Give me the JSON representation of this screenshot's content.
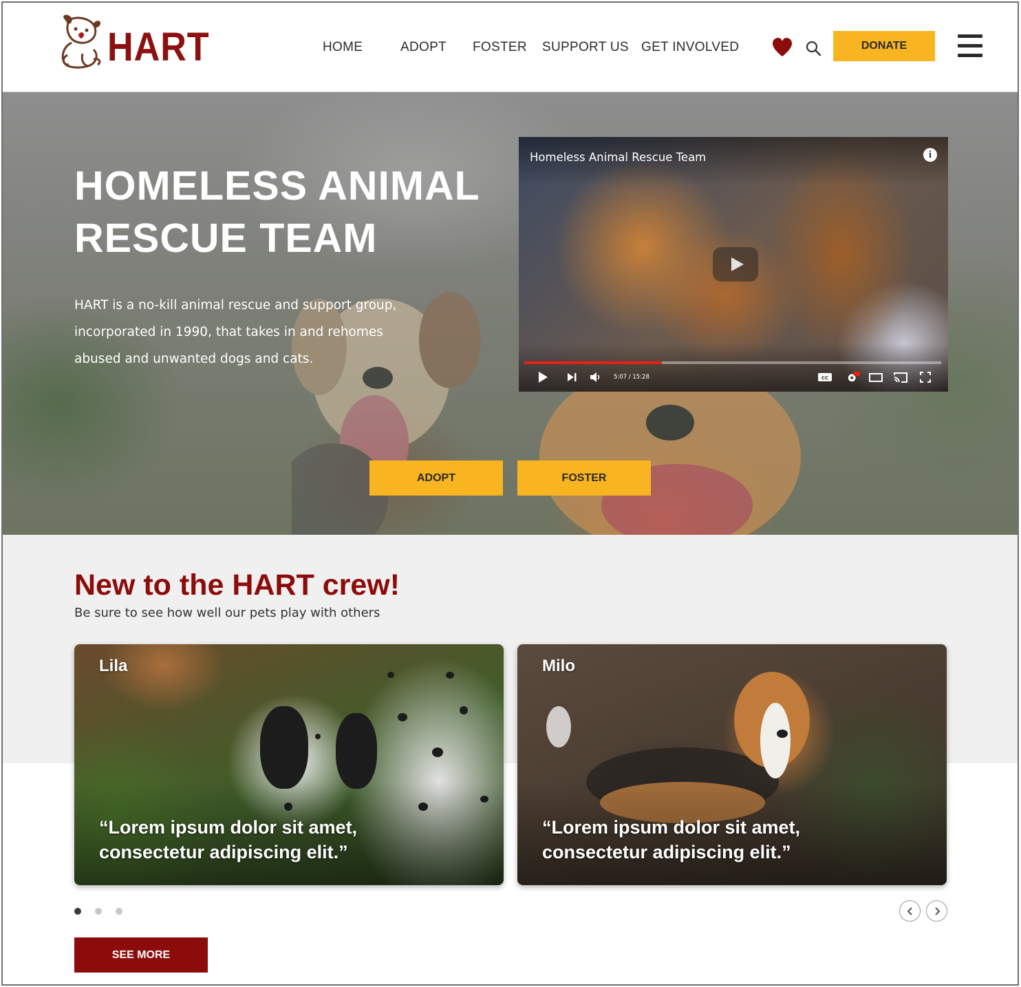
{
  "brand": {
    "name": "HART",
    "color": "#8c1010"
  },
  "nav": {
    "items": [
      {
        "label": "HOME"
      },
      {
        "label": "ADOPT"
      },
      {
        "label": "FOSTER"
      },
      {
        "label": "SUPPORT US"
      },
      {
        "label": "GET INVOLVED"
      }
    ],
    "donate_label": "DONATE",
    "icons": [
      "heart-icon",
      "search-icon",
      "menu-icon"
    ]
  },
  "hero": {
    "title_line1": "HOMELESS ANIMAL",
    "title_line2": "RESCUE TEAM",
    "description": "HART is a no-kill animal rescue and support group, incorporated in 1990, that takes in and rehomes abused and unwanted dogs and cats.",
    "adopt_label": "ADOPT",
    "foster_label": "FOSTER",
    "accent_color": "#f8b521"
  },
  "video": {
    "title": "Homeless Animal Rescue Team",
    "time_display": "5:07 / 15:28",
    "progress": 0.33,
    "progress_color": "#e62117"
  },
  "crew": {
    "title": "New to the HART crew!",
    "subtitle": "Be sure to see how well our pets play with others",
    "cards": [
      {
        "name": "Lila",
        "quote": "“Lorem ipsum dolor sit amet, consectetur adipiscing elit.”"
      },
      {
        "name": "Milo",
        "quote": "“Lorem ipsum dolor sit amet, consectetur adipiscing elit.”"
      }
    ],
    "pagination": {
      "total": 3,
      "active": 1
    },
    "see_more_label": "SEE MORE"
  }
}
